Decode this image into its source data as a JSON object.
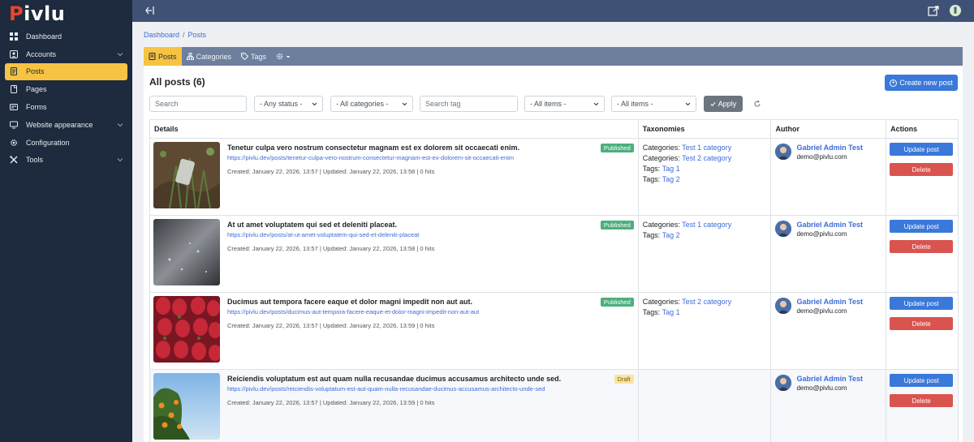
{
  "app": {
    "logo_first": "P",
    "logo_rest": "ivlu",
    "accent_color": "#f6c343",
    "brand_color": "#e8462e"
  },
  "sidebar": {
    "items": [
      {
        "label": "Dashboard",
        "icon": "grid-icon",
        "active": false,
        "has_chevron": false
      },
      {
        "label": "Accounts",
        "icon": "users-icon",
        "active": false,
        "has_chevron": true
      },
      {
        "label": "Posts",
        "icon": "document-icon",
        "active": true,
        "has_chevron": false
      },
      {
        "label": "Pages",
        "icon": "pages-icon",
        "active": false,
        "has_chevron": false
      },
      {
        "label": "Forms",
        "icon": "form-icon",
        "active": false,
        "has_chevron": false
      },
      {
        "label": "Website appearance",
        "icon": "monitor-icon",
        "active": false,
        "has_chevron": true
      },
      {
        "label": "Configuration",
        "icon": "gear-icon",
        "active": false,
        "has_chevron": false
      },
      {
        "label": "Tools",
        "icon": "tools-icon",
        "active": false,
        "has_chevron": true
      }
    ]
  },
  "breadcrumb": {
    "root": "Dashboard",
    "separator": "/",
    "current": "Posts"
  },
  "tabs": {
    "posts": "Posts",
    "categories": "Categories",
    "tags": "Tags"
  },
  "panel": {
    "title": "All posts (6)",
    "create_label": "Create new post"
  },
  "filters": {
    "search_placeholder": "Search",
    "status": "- Any status -",
    "categories": "- All categories -",
    "tag_placeholder": "Search tag",
    "items_1": "- All items -",
    "items_2": "- All items -",
    "apply_label": "Apply"
  },
  "table": {
    "headers": {
      "details": "Details",
      "taxonomies": "Taxonomies",
      "author": "Author",
      "actions": "Actions"
    },
    "update_label": "Update post",
    "delete_label": "Delete",
    "rows": [
      {
        "title": "Tenetur culpa vero nostrum consectetur magnam est ex dolorem sit occaecati enim.",
        "url": "https://pivlu.dev/posts/tenetur-culpa-vero-nostrum-consectetur-magnam-est-ex-dolorem-sit-occaecati-enim",
        "meta": "Created: January 22, 2026, 13:57 | Updated: January 22, 2026, 13:58 | 0 hits",
        "status": "Published",
        "thumb": "plant-on-soil",
        "taxonomies": [
          {
            "label": "Categories:",
            "value": "Test 1 category"
          },
          {
            "label": "Categories:",
            "value": "Test 2 category"
          },
          {
            "label": "Tags:",
            "value": "Tag 1"
          },
          {
            "label": "Tags:",
            "value": "Tag 2"
          }
        ],
        "author_name": "Gabriel Admin Test",
        "author_email": "demo@pivlu.com"
      },
      {
        "title": "At ut amet voluptatem qui sed et deleniti placeat.",
        "url": "https://pivlu.dev/posts/at-ut-amet-voluptatem-qui-sed-et-deleniti-placeat",
        "meta": "Created: January 22, 2026, 13:57 | Updated: January 22, 2026, 13:58 | 0 hits",
        "status": "Published",
        "thumb": "wet-pavement",
        "taxonomies": [
          {
            "label": "Categories:",
            "value": "Test 1 category"
          },
          {
            "label": "Tags:",
            "value": "Tag 2"
          }
        ],
        "author_name": "Gabriel Admin Test",
        "author_email": "demo@pivlu.com"
      },
      {
        "title": "Ducimus aut tempora facere eaque et dolor magni impedit non aut aut.",
        "url": "https://pivlu.dev/posts/ducimus-aut-tempora-facere-eaque-et-dolor-magni-impedit-non-aut-aut",
        "meta": "Created: January 22, 2026, 13:57 | Updated: January 22, 2026, 13:59 | 0 hits",
        "status": "Published",
        "thumb": "strawberries",
        "taxonomies": [
          {
            "label": "Categories:",
            "value": "Test 2 category"
          },
          {
            "label": "Tags:",
            "value": "Tag 1"
          }
        ],
        "author_name": "Gabriel Admin Test",
        "author_email": "demo@pivlu.com"
      },
      {
        "title": "Reiciendis voluptatum est aut quam nulla recusandae ducimus accusamus architecto unde sed.",
        "url": "https://pivlu.dev/posts/reiciendis-voluptatum-est-aut-quam-nulla-recusandae-ducimus-accusamus-architecto-unde-sed",
        "meta": "Created: January 22, 2026, 13:57 | Updated: January 22, 2026, 13:59 | 0 hits",
        "status": "Draft",
        "thumb": "orange-tree",
        "taxonomies": [],
        "author_name": "Gabriel Admin Test",
        "author_email": "demo@pivlu.com"
      }
    ]
  }
}
